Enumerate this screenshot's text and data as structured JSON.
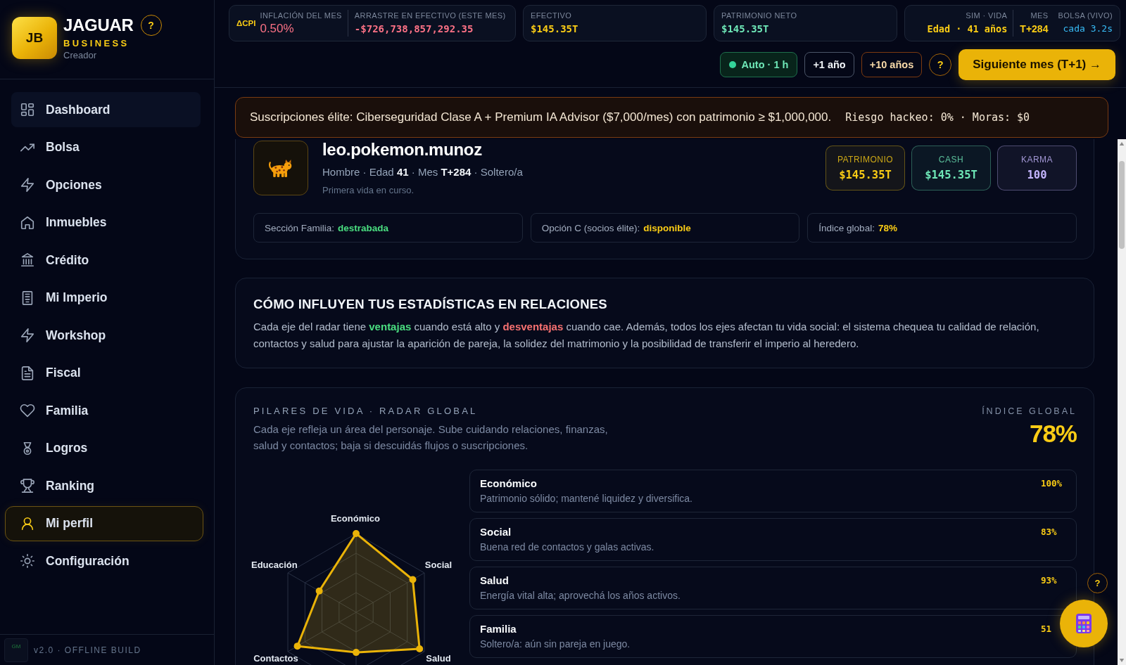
{
  "sidebar": {
    "brand": {
      "logo": "JB",
      "name": "JAGUAR",
      "help": "?",
      "tagline": "BUSINESS",
      "role": "Creador"
    },
    "items": [
      {
        "label": "Dashboard",
        "selected": false,
        "hovered": true
      },
      {
        "label": "Bolsa",
        "selected": false,
        "hovered": false
      },
      {
        "label": "Opciones",
        "selected": false,
        "hovered": false
      },
      {
        "label": "Inmuebles",
        "selected": false,
        "hovered": false
      },
      {
        "label": "Crédito",
        "selected": false,
        "hovered": false
      },
      {
        "label": "Mi Imperio",
        "selected": false,
        "hovered": false
      },
      {
        "label": "Workshop",
        "selected": false,
        "hovered": false
      },
      {
        "label": "Fiscal",
        "selected": false,
        "hovered": false
      },
      {
        "label": "Familia",
        "selected": false,
        "hovered": false
      },
      {
        "label": "Logros",
        "selected": false,
        "hovered": false
      },
      {
        "label": "Ranking",
        "selected": false,
        "hovered": false
      },
      {
        "label": "Mi perfil",
        "selected": true,
        "hovered": false
      },
      {
        "label": "Configuración",
        "selected": false,
        "hovered": false
      }
    ],
    "footer": {
      "badge": "GM",
      "text": "v2.0 · OFFLINE BUILD"
    }
  },
  "topbar": {
    "stat_cards": [
      {
        "kind": "cpi",
        "badge": "ΔCPI",
        "fields": [
          {
            "label": "INFLACIÓN DEL MES",
            "value": "0.50%",
            "color": "#fb7185",
            "kind": "plain"
          },
          {
            "label": "ARRASTRE EN EFECTIVO (ESTE MES)",
            "value": "-$726,738,857,292.35",
            "color": "#fb7185",
            "kind": "mono"
          }
        ]
      },
      {
        "kind": "metric",
        "fields": [
          {
            "label": "EFECTIVO",
            "value": "$145.35T",
            "color": "#facc15",
            "kind": "mono"
          }
        ]
      },
      {
        "kind": "metric",
        "fields": [
          {
            "label": "PATRIMONIO NETO",
            "value": "$145.35T",
            "color": "#6ee7b7",
            "kind": "mono"
          }
        ]
      },
      {
        "kind": "sim",
        "fields": [
          {
            "label": "SIM · VIDA",
            "value": "Edad · 41 años",
            "color": "#facc15",
            "kind": "mono"
          },
          {
            "label": "MES",
            "value": "T+284",
            "color": "#facc15",
            "kind": "plain"
          },
          {
            "label": "BOLSA (VIVO)",
            "value": "cada 3.2s",
            "color": "#38bdf8",
            "kind": "mono_light"
          }
        ]
      }
    ],
    "actions": [
      {
        "label": "Auto · 1 h",
        "kind": "auto",
        "on": true
      },
      {
        "label": "+1 año",
        "kind": "step",
        "on": false
      },
      {
        "label": "+10 años",
        "kind": "step_big",
        "on": false
      },
      {
        "label": "?",
        "kind": "help",
        "on": false
      },
      {
        "label": "Siguiente mes (T+1) →",
        "kind": "primary",
        "on": false
      }
    ]
  },
  "banner": {
    "message": "Suscripciones élite: Ciberseguridad Clase A + Premium IA Advisor ($7,000/mes) con patrimonio ≥ $1,000,000.",
    "status": "Riesgo hackeo: 0% · Moras: $0"
  },
  "profile": {
    "name": "leo.pokemon.munoz",
    "meta": "Hombre · Edad **41** · Mes **T+284** · Soltero/a",
    "note": "Primera vida en curso.",
    "stats": [
      {
        "label": "PATRIMONIO",
        "value": "$145.35T",
        "color": "#facc15"
      },
      {
        "label": "CASH",
        "value": "$145.35T",
        "color": "#6ee7b7"
      },
      {
        "label": "KARMA",
        "value": "100",
        "color": "#c4b5fd"
      }
    ],
    "flags": [
      {
        "label": "Sección Familia:",
        "value": "destrabada",
        "color": "#4ade80"
      },
      {
        "label": "Opción C (socios élite):",
        "value": "disponible",
        "color": "#facc15"
      },
      {
        "label": "Índice global:",
        "value": "78%",
        "color": "#facc15"
      }
    ]
  },
  "relations": {
    "title": "CÓMO INFLUYEN TUS ESTADÍSTICAS EN RELACIONES",
    "body": [
      {
        "text": "Cada eje del radar tiene ",
        "kind": "plain"
      },
      {
        "text": "ventajas",
        "kind": "good"
      },
      {
        "text": " cuando está alto y ",
        "kind": "plain"
      },
      {
        "text": "desventajas",
        "kind": "bad"
      },
      {
        "text": " cuando cae. Además, todos los ejes afectan tu vida social: el sistema chequea tu calidad de relación, contactos y salud para ajustar la aparición de pareja, la solidez del matrimonio y la posibilidad de transferir el imperio al heredero.",
        "kind": "plain"
      }
    ]
  },
  "pillars": {
    "title": "PILARES DE VIDA · RADAR GLOBAL",
    "description": "Cada eje refleja un área del personaje. Sube cuidando relaciones, finanzas, salud y contactos; baja si descuidás flujos o suscripciones.",
    "index_label": "ÍNDICE GLOBAL",
    "index_value": "78%",
    "radar": {
      "axes": [
        "Económico",
        "Social",
        "Salud",
        "Contactos",
        "Educación"
      ]
    },
    "items": [
      {
        "name": "Económico",
        "description": "Patrimonio sólido; mantené liquidez y diversifica.",
        "value": "100%"
      },
      {
        "name": "Social",
        "description": "Buena red de contactos y galas activas.",
        "value": "83%"
      },
      {
        "name": "Salud",
        "description": "Energía vital alta; aprovechá los años activos.",
        "value": "93%"
      },
      {
        "name": "Familia",
        "description": "Soltero/a: aún sin pareja en juego.",
        "value": "51"
      }
    ]
  },
  "floating": {
    "help": "?"
  }
}
